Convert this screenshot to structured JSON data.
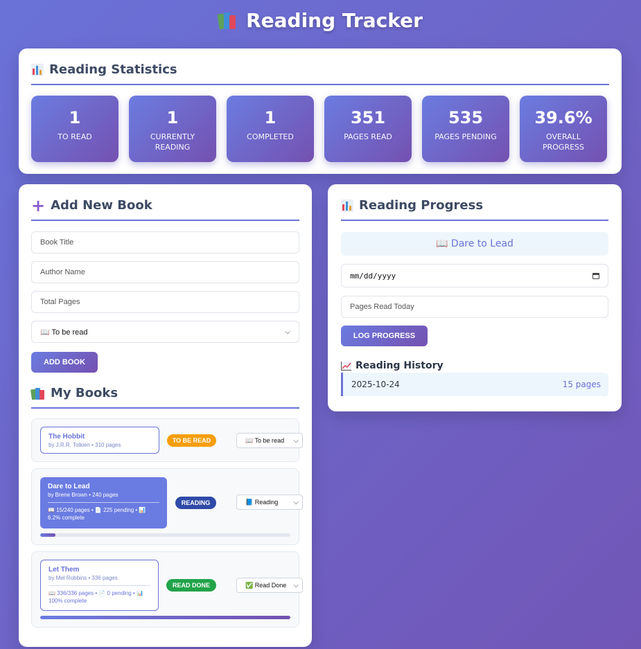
{
  "header": {
    "title": "Reading Tracker",
    "icon": "books-icon"
  },
  "stats": {
    "title": "Reading Statistics",
    "items": [
      {
        "value": "1",
        "label": "To Read"
      },
      {
        "value": "1",
        "label": "Currently Reading"
      },
      {
        "value": "1",
        "label": "Completed"
      },
      {
        "value": "351",
        "label": "Pages Read"
      },
      {
        "value": "535",
        "label": "Pages Pending"
      },
      {
        "value": "39.6%",
        "label": "Overall Progress"
      }
    ]
  },
  "add_book": {
    "title": "Add New Book",
    "title_placeholder": "Book Title",
    "author_placeholder": "Author Name",
    "pages_placeholder": "Total Pages",
    "status_selected": "📖 To be read",
    "button_label": "Add Book"
  },
  "my_books": {
    "title": "My Books",
    "items": [
      {
        "title": "The Hobbit",
        "meta": "by J.R.R. Tolkien • 310 pages",
        "badge": "To Be Read",
        "badge_color": "#f59e0b",
        "status": "📖 To be read"
      },
      {
        "title": "Dare to Lead",
        "meta": "by Brene Brown • 240 pages",
        "stats": "📖 15/240 pages • 📄 225 pending • 📊 6.2% complete",
        "badge": "Reading",
        "badge_color": "#2f4aa8",
        "status": "📘 Reading",
        "progress": 0.062
      },
      {
        "title": "Let Them",
        "meta": "by Mel Robbins • 336 pages",
        "stats": "📖 336/336 pages • 📄 0 pending • 📊 100% complete",
        "badge": "Read Done",
        "badge_color": "#22a34a",
        "status": "✅ Read Done",
        "progress": 1.0
      }
    ]
  },
  "progress": {
    "title": "Reading Progress",
    "current_book": "📖 Dare to Lead",
    "date_placeholder": "mm/dd/yyyy",
    "pages_placeholder": "Pages Read Today",
    "button_label": "Log Progress",
    "history_title": "Reading History",
    "history": [
      {
        "date": "2025-10-24",
        "pages": "15 pages"
      }
    ]
  },
  "colors": {
    "accent": "#6a72d8",
    "gradient_start": "#6b7ce0",
    "gradient_end": "#7451b0"
  }
}
